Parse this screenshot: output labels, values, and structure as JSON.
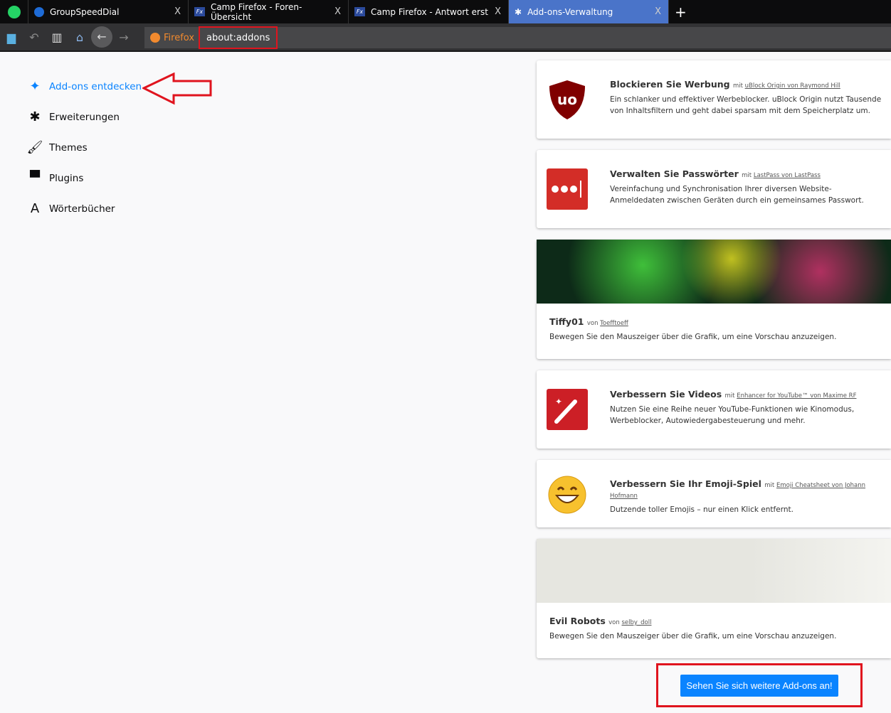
{
  "tabs": [
    {
      "label": "GroupSpeedDial"
    },
    {
      "label": "Camp Firefox - Foren-Übersicht"
    },
    {
      "label": "Camp Firefox - Antwort erstelle"
    },
    {
      "label": "Add-ons-Verwaltung",
      "active": true
    }
  ],
  "close_glyph": "X",
  "new_tab": "+",
  "nav": {
    "identity": "Firefox",
    "url": "about:addons"
  },
  "sidebar": [
    {
      "label": "Add-ons entdecken",
      "icon": "sparkle-icon"
    },
    {
      "label": "Erweiterungen",
      "icon": "puzzle-icon"
    },
    {
      "label": "Themes",
      "icon": "brush-icon"
    },
    {
      "label": "Plugins",
      "icon": "plugin-icon"
    },
    {
      "label": "Wörterbücher",
      "icon": "dictionary-icon"
    }
  ],
  "cards": [
    {
      "title": "Blockieren Sie Werbung",
      "by_prefix": "mit",
      "by": "uBlock Origin von Raymond Hill",
      "desc": "Ein schlanker und effektiver Werbeblocker. uBlock Origin nutzt Tausende von Inhaltsfiltern und geht dabei sparsam mit dem Speicherplatz um."
    },
    {
      "title": "Verwalten Sie Passwörter",
      "by_prefix": "mit",
      "by": "LastPass von LastPass",
      "desc": "Vereinfachung und Synchronisation Ihrer diversen Website-Anmeldedaten zwischen Geräten durch ein gemeinsames Passwort."
    },
    {
      "title": "Tiffy01",
      "by_prefix": "von",
      "by": "Toefftoeff",
      "desc": "Bewegen Sie den Mauszeiger über die Grafik, um eine Vorschau anzuzeigen."
    },
    {
      "title": "Verbessern Sie Videos",
      "by_prefix": "mit",
      "by": "Enhancer for YouTube™ von Maxime RF",
      "desc": "Nutzen Sie eine Reihe neuer YouTube-Funktionen wie Kinomodus, Werbeblocker, Autowiedergabesteuerung und mehr."
    },
    {
      "title": "Verbessern Sie Ihr Emoji-Spiel",
      "by_prefix": "mit",
      "by": "Emoji Cheatsheet von Johann Hofmann",
      "desc": "Dutzende toller Emojis – nur einen Klick entfernt."
    },
    {
      "title": "Evil Robots",
      "by_prefix": "von",
      "by": "selby_doll",
      "desc": "Bewegen Sie den Mauszeiger über die Grafik, um eine Vorschau anzuzeigen."
    }
  ],
  "more_button": "Sehen Sie sich weitere Add-ons an!",
  "colors": {
    "accent": "#0a84ff",
    "highlight": "#e0141e",
    "active_tab": "#4a74c9"
  }
}
